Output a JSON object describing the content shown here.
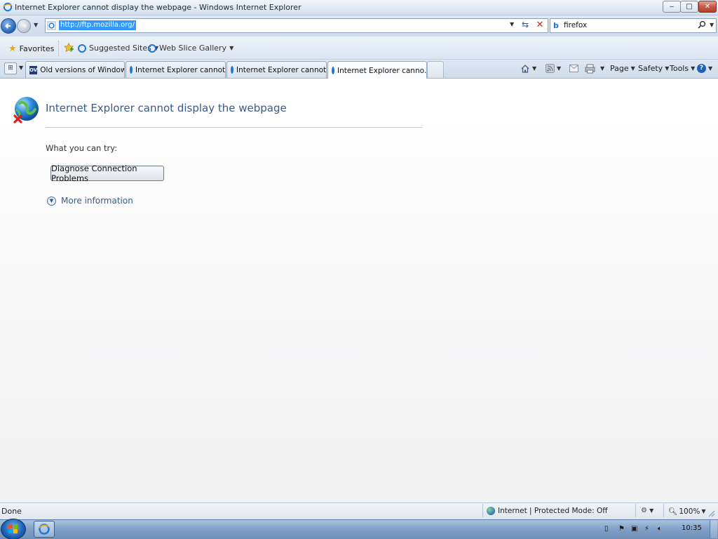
{
  "window": {
    "title": "Internet Explorer cannot display the webpage - Windows Internet Explorer",
    "min_glyph": "‒",
    "max_glyph": "□",
    "close_glyph": "✕"
  },
  "address": {
    "url": "http://ftp.mozilla.org/"
  },
  "search": {
    "query": "firefox",
    "provider_glyph": "b"
  },
  "favorites_bar": {
    "favorites_label": "Favorites",
    "suggested_sites_label": "Suggested Sites",
    "web_slice_label": "Web Slice Gallery"
  },
  "tabs": [
    {
      "label": "Old versions of Windows, ...",
      "icon_text": "OV"
    },
    {
      "label": "Internet Explorer cannot di..."
    },
    {
      "label": "Internet Explorer cannot di..."
    },
    {
      "label": "Internet Explorer canno...",
      "close": "x"
    }
  ],
  "command_bar": {
    "page_label": "Page",
    "safety_label": "Safety",
    "tools_label": "Tools",
    "help_glyph": "?"
  },
  "error_page": {
    "title": "Internet Explorer cannot display the webpage",
    "try_label": "What you can try:",
    "diagnose_label": "Diagnose Connection Problems",
    "more_info_label": "More information"
  },
  "status_bar": {
    "status": "Done",
    "zone": "Internet | Protected Mode: Off",
    "zoom": "100%"
  },
  "taskbar": {
    "clock": "10:35"
  },
  "colors": {
    "link": "#2f5c9c",
    "title": "#3a5a89",
    "selection": "#3399ff"
  },
  "icons": [
    "ie-icon",
    "back-arrow-icon",
    "forward-arrow-icon",
    "refresh-icon",
    "stop-icon",
    "bing-icon",
    "search-icon",
    "star-icon",
    "add-favorite-icon",
    "quick-tabs-icon",
    "home-icon",
    "feeds-icon",
    "mail-icon",
    "print-icon",
    "help-icon",
    "globe-error-icon",
    "expand-circle-icon",
    "globe-zone-icon",
    "zoom-icon",
    "windows-start-icon"
  ]
}
